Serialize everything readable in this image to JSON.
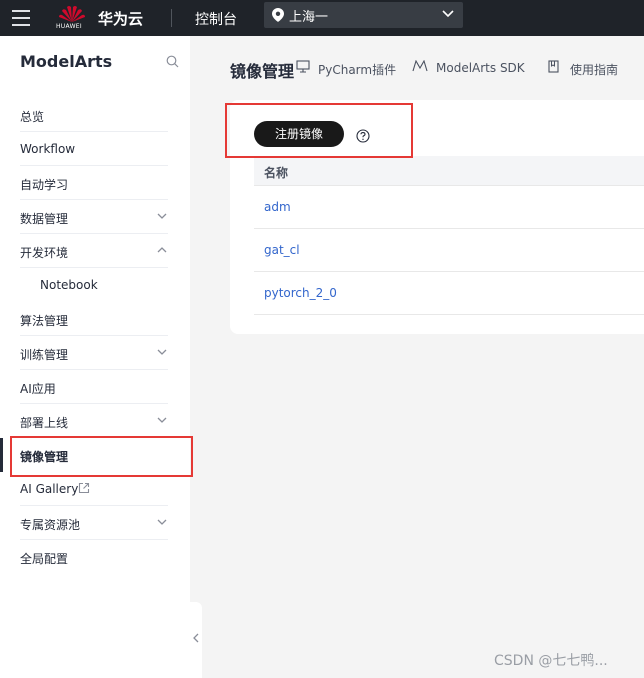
{
  "topbar": {
    "logo_text": "HUAWEI",
    "brand": "华为云",
    "console": "控制台",
    "region": "上海一"
  },
  "sidebar": {
    "title": "ModelArts",
    "items": [
      {
        "label": "总览"
      },
      {
        "label": "Workflow"
      },
      {
        "label": "自动学习"
      },
      {
        "label": "数据管理",
        "caret": "down"
      },
      {
        "label": "开发环境",
        "caret": "up"
      },
      {
        "label": "Notebook",
        "sub": true
      },
      {
        "label": "算法管理"
      },
      {
        "label": "训练管理",
        "caret": "down"
      },
      {
        "label": "AI应用"
      },
      {
        "label": "部署上线",
        "caret": "down"
      },
      {
        "label": "镜像管理",
        "active": true
      },
      {
        "label": "AI Gallery",
        "external": true
      },
      {
        "label": "专属资源池",
        "caret": "down"
      },
      {
        "label": "全局配置"
      }
    ]
  },
  "main": {
    "title": "镜像管理",
    "links": {
      "pycharm": "PyCharm插件",
      "sdk": "ModelArts SDK",
      "guide": "使用指南"
    },
    "register_button": "注册镜像",
    "table": {
      "header": "名称",
      "rows": [
        "adm",
        "gat_cl",
        "pytorch_2_0"
      ]
    }
  },
  "watermark": "CSDN @七七鸭...",
  "colors": {
    "topbar": "#1f2329",
    "accent": "#e53935",
    "link": "#3366cc"
  }
}
